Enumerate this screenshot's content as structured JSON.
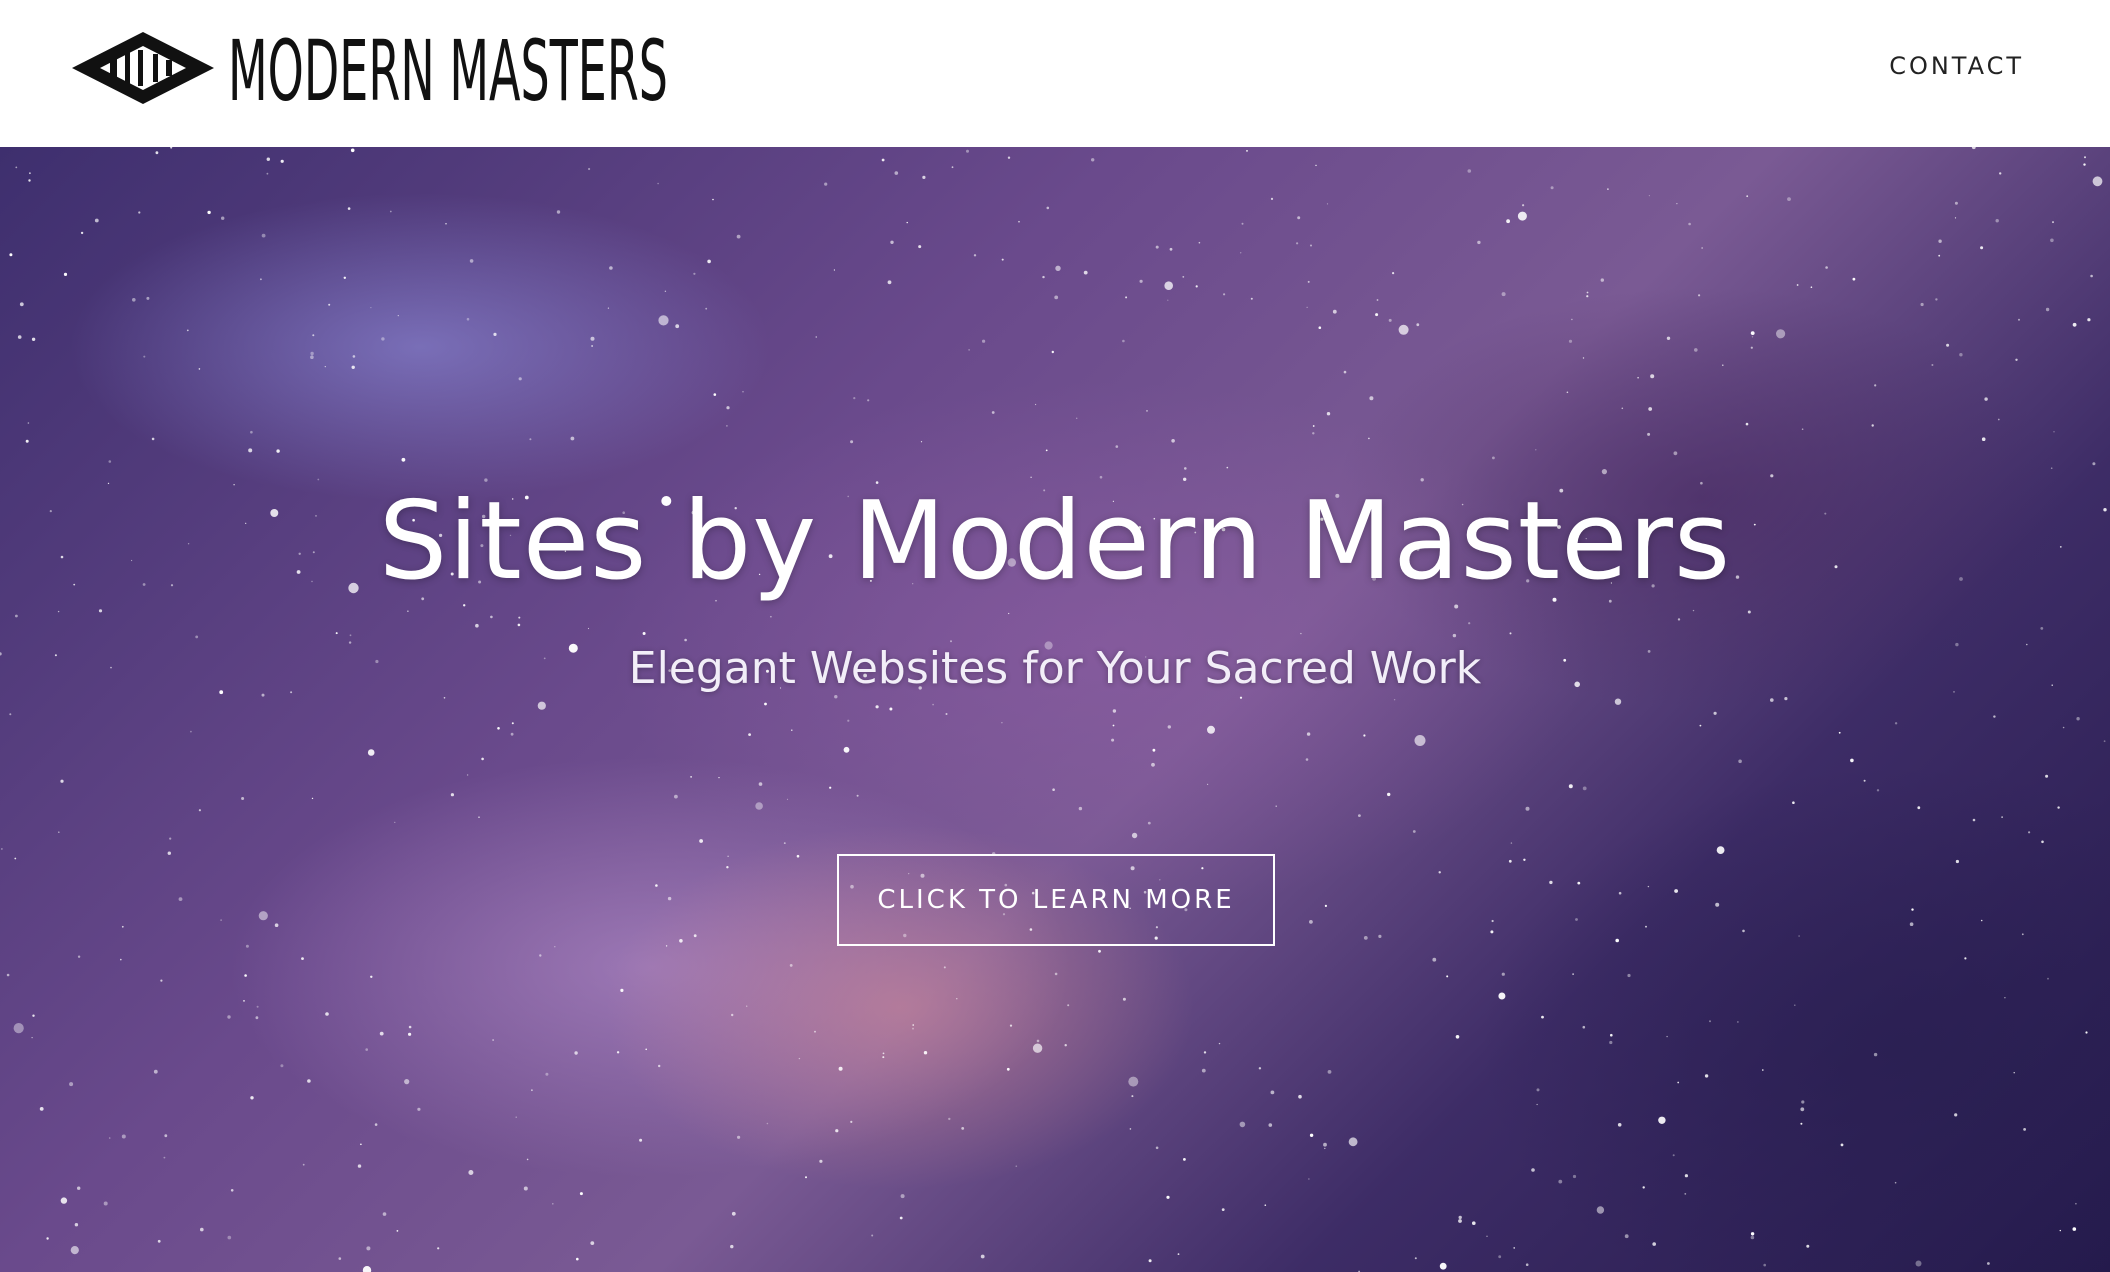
{
  "header": {
    "brand": "MODERN MASTERS",
    "nav": {
      "contact_label": "CONTACT"
    }
  },
  "hero": {
    "title": "Sites by Modern Masters",
    "subtitle": "Elegant Websites for Your Sacred Work",
    "cta_label": "CLICK TO LEARN MORE",
    "background": "starry-galaxy-image"
  },
  "colors": {
    "header_bg": "#ffffff",
    "hero_text": "#ffffff",
    "nav_text": "#222222",
    "logo": "#111111"
  }
}
